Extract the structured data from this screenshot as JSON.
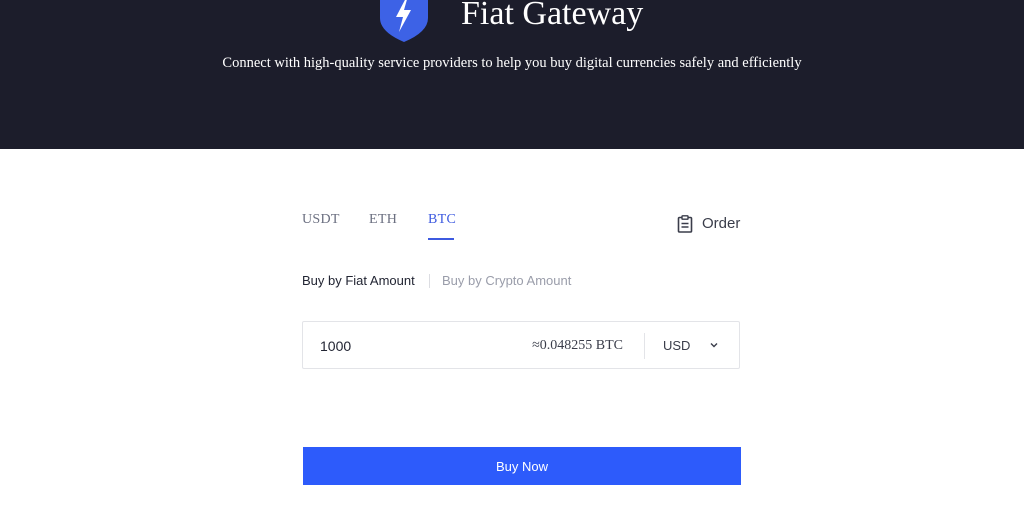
{
  "header": {
    "title": "Fiat Gateway",
    "subtitle": "Connect with high-quality service providers to help you buy digital currencies safely and efficiently"
  },
  "tabs": [
    {
      "label": "USDT",
      "active": false
    },
    {
      "label": "ETH",
      "active": false
    },
    {
      "label": "BTC",
      "active": true
    }
  ],
  "order": {
    "label": "Order",
    "icon": "clipboard-icon"
  },
  "buy_mode": {
    "fiat_label": "Buy by Fiat Amount",
    "crypto_label": "Buy by Crypto Amount",
    "active": "fiat"
  },
  "amount": {
    "value": "1000",
    "conversion": "≈0.048255 BTC",
    "currency": "USD"
  },
  "buy_button": {
    "label": "Buy Now"
  },
  "colors": {
    "header_bg": "#1c1d2b",
    "accent": "#3d5ae0",
    "button": "#2d5bfb",
    "logo": "#3d62e6"
  }
}
